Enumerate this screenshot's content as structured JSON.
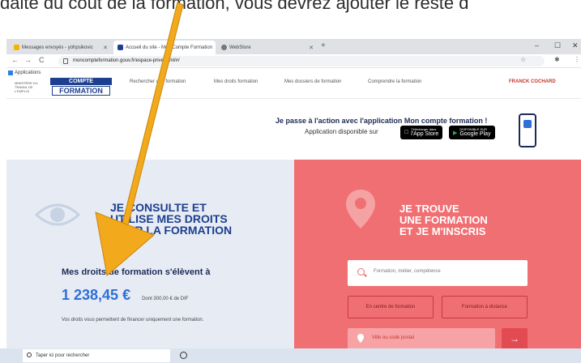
{
  "caption": "daite du coût de la formation, vous devrez ajouter le reste d",
  "browser": {
    "tabs": [
      {
        "label": "Messages envoyés - yohpsikovic",
        "favicon_color": "#f4b400"
      },
      {
        "label": "Accueil du site - Mon Compte Formation",
        "favicon_color": "#1d3f8f"
      },
      {
        "label": "WebStore",
        "favicon_color": "#777777"
      }
    ],
    "new_tab": "+",
    "window_controls": [
      "–",
      "☐",
      "✕"
    ],
    "url": "moncompteformation.gouv.fr/espace-prive/html/#/",
    "bookmarks_label": "Applications"
  },
  "site": {
    "logo_top": "COMPTE",
    "logo_bottom": "FORMATION",
    "gov_text": "MINISTÈRE DU TRAVAIL DE L'EMPLOI",
    "nav": [
      "Rechercher une formation",
      "Mes droits formation",
      "Mes dossiers de formation",
      "Comprendre la formation"
    ],
    "account": "FRANCK COCHARD"
  },
  "promo": {
    "title": "Je passe à l'action avec l'application Mon compte formation !",
    "subtitle": "Application disponible sur",
    "app_store_small": "Télécharger dans",
    "app_store": "l'App Store",
    "google_play_small": "DISPONIBLE SUR",
    "google_play": "Google Play"
  },
  "left": {
    "heading": [
      "JE CONSULTE ET",
      "UTILISE MES DROITS",
      "POUR LA FORMATION"
    ],
    "rights_title": "Mes droits de formation s'élèvent à",
    "amount": "1 238,45 €",
    "amount_note": "Dont 300,00 € de DIF",
    "description": "Vos droits vous permettent de financer uniquement une formation."
  },
  "right": {
    "heading": [
      "JE TROUVE",
      "UNE FORMATION",
      "ET JE M'INSCRIS"
    ],
    "search_placeholder": "Formation, métier, compétence",
    "chip_center": "En centre de formation",
    "chip_remote": "Formation à distance",
    "location_placeholder": "Ville ou code postal",
    "go": "→"
  },
  "taskbar": {
    "search_placeholder": "Taper ici pour rechercher"
  },
  "colors": {
    "brand_blue": "#1d3f8f",
    "amount_blue": "#2e6fd8",
    "coral": "#f06f73",
    "arrow": "#f2a91b"
  }
}
